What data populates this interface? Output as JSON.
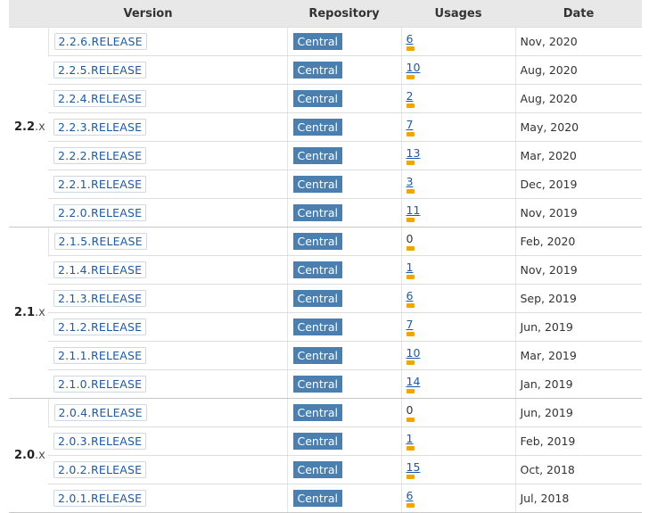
{
  "headers": {
    "version": "Version",
    "repository": "Repository",
    "usages": "Usages",
    "date": "Date"
  },
  "groups": [
    {
      "label_bold": "2.2",
      "label_suffix": ".x",
      "rows": [
        {
          "version": "2.2.6.RELEASE",
          "repo": "Central",
          "usages": "6",
          "date": "Nov, 2020"
        },
        {
          "version": "2.2.5.RELEASE",
          "repo": "Central",
          "usages": "10",
          "date": "Aug, 2020"
        },
        {
          "version": "2.2.4.RELEASE",
          "repo": "Central",
          "usages": "2",
          "date": "Aug, 2020"
        },
        {
          "version": "2.2.3.RELEASE",
          "repo": "Central",
          "usages": "7",
          "date": "May, 2020"
        },
        {
          "version": "2.2.2.RELEASE",
          "repo": "Central",
          "usages": "13",
          "date": "Mar, 2020"
        },
        {
          "version": "2.2.1.RELEASE",
          "repo": "Central",
          "usages": "3",
          "date": "Dec, 2019"
        },
        {
          "version": "2.2.0.RELEASE",
          "repo": "Central",
          "usages": "11",
          "date": "Nov, 2019"
        }
      ]
    },
    {
      "label_bold": "2.1",
      "label_suffix": ".x",
      "rows": [
        {
          "version": "2.1.5.RELEASE",
          "repo": "Central",
          "usages": "0",
          "date": "Feb, 2020"
        },
        {
          "version": "2.1.4.RELEASE",
          "repo": "Central",
          "usages": "1",
          "date": "Nov, 2019"
        },
        {
          "version": "2.1.3.RELEASE",
          "repo": "Central",
          "usages": "6",
          "date": "Sep, 2019"
        },
        {
          "version": "2.1.2.RELEASE",
          "repo": "Central",
          "usages": "7",
          "date": "Jun, 2019"
        },
        {
          "version": "2.1.1.RELEASE",
          "repo": "Central",
          "usages": "10",
          "date": "Mar, 2019"
        },
        {
          "version": "2.1.0.RELEASE",
          "repo": "Central",
          "usages": "14",
          "date": "Jan, 2019"
        }
      ]
    },
    {
      "label_bold": "2.0",
      "label_suffix": ".x",
      "rows": [
        {
          "version": "2.0.4.RELEASE",
          "repo": "Central",
          "usages": "0",
          "date": "Jun, 2019"
        },
        {
          "version": "2.0.3.RELEASE",
          "repo": "Central",
          "usages": "1",
          "date": "Feb, 2019"
        },
        {
          "version": "2.0.2.RELEASE",
          "repo": "Central",
          "usages": "15",
          "date": "Oct, 2018"
        },
        {
          "version": "2.0.1.RELEASE",
          "repo": "Central",
          "usages": "6",
          "date": "Jul, 2018"
        }
      ]
    }
  ]
}
